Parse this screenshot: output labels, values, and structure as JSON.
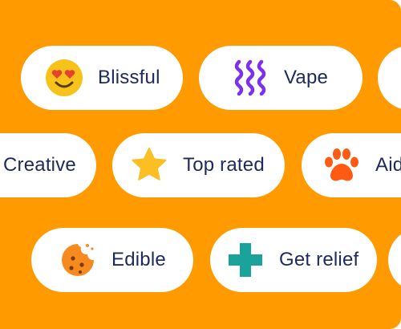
{
  "colors": {
    "background": "#ff9a00",
    "pill": "#ffffff",
    "text": "#1d2a5c",
    "emoji": "#f7c31a",
    "waves": "#7b2ff0",
    "star": "#fbbf24",
    "paw": "#ff5a14",
    "cookie": "#f68a1e",
    "plus": "#1aa39a"
  },
  "chips": [
    {
      "label": "Blissful",
      "icon": "heart-eyes-emoji-icon"
    },
    {
      "label": "Vape",
      "icon": "vape-waves-icon"
    },
    {
      "label": "Creative",
      "icon": ""
    },
    {
      "label": "Top rated",
      "icon": "star-icon"
    },
    {
      "label": "Aid",
      "icon": "paw-icon"
    },
    {
      "label": "Edible",
      "icon": "cookie-icon"
    },
    {
      "label": "Get relief",
      "icon": "plus-cross-icon"
    }
  ]
}
